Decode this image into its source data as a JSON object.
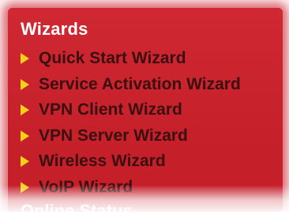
{
  "sidebar": {
    "section_title": "Wizards",
    "items": [
      {
        "label": "Quick Start Wizard",
        "icon": "arrow-right-icon"
      },
      {
        "label": "Service Activation Wizard",
        "icon": "arrow-right-icon"
      },
      {
        "label": "VPN Client Wizard",
        "icon": "arrow-right-icon"
      },
      {
        "label": "VPN Server Wizard",
        "icon": "arrow-right-icon"
      },
      {
        "label": "Wireless Wizard",
        "icon": "arrow-right-icon"
      },
      {
        "label": "VoIP Wizard",
        "icon": "arrow-right-icon"
      }
    ],
    "next_section_title": "Online Status"
  },
  "colors": {
    "panel_background": "#c8212b",
    "title_text": "#ffffff",
    "item_text": "#3a1010",
    "arrow": "#f4d21a"
  }
}
